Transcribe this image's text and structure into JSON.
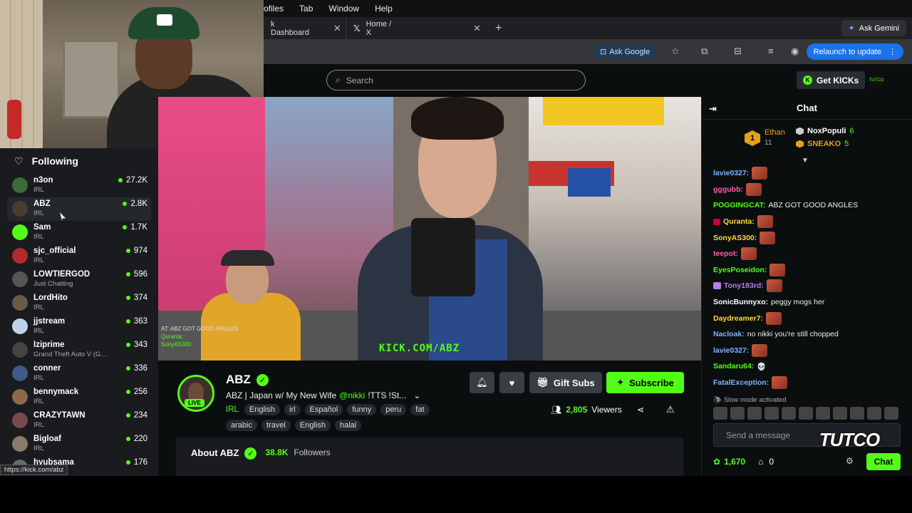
{
  "menubar": {
    "items": [
      "ofiles",
      "Tab",
      "Window",
      "Help"
    ]
  },
  "tabs": [
    {
      "label": "k Dashboard"
    },
    {
      "label": "Home / X"
    }
  ],
  "ask_gemini": "Ask Gemini",
  "toolbar": {
    "ask_google": "Ask Google",
    "relaunch": "Relaunch to update"
  },
  "header": {
    "search_placeholder": "Search",
    "get_kicks": "Get KICKs",
    "avatar_label": "TUTCO"
  },
  "sidebar": {
    "title": "Following",
    "items": [
      {
        "name": "n3on",
        "category": "IRL",
        "viewers": "27.2K",
        "color": "#3b6b3b"
      },
      {
        "name": "ABZ",
        "category": "IRL",
        "viewers": "2.8K",
        "color": "#4a3b30"
      },
      {
        "name": "Sam",
        "category": "IRL",
        "viewers": "1.7K",
        "color": "#53fc18"
      },
      {
        "name": "sjc_official",
        "category": "IRL",
        "viewers": "974",
        "color": "#b02b2b"
      },
      {
        "name": "LOWTIERGOD",
        "category": "Just Chatting",
        "viewers": "596",
        "color": "#555"
      },
      {
        "name": "LordHito",
        "category": "IRL",
        "viewers": "374",
        "color": "#6a5a4a"
      },
      {
        "name": "jjstream",
        "category": "IRL",
        "viewers": "363",
        "color": "#bcd3ea"
      },
      {
        "name": "Iziprime",
        "category": "Grand Theft Auto V (G...",
        "viewers": "343",
        "color": "#444"
      },
      {
        "name": "conner",
        "category": "IRL",
        "viewers": "336",
        "color": "#3f5a8a"
      },
      {
        "name": "bennymack",
        "category": "IRL",
        "viewers": "256",
        "color": "#8a6a4a"
      },
      {
        "name": "CRAZYTAWN",
        "category": "IRL",
        "viewers": "234",
        "color": "#7a4a4a"
      },
      {
        "name": "Bigloaf",
        "category": "IRL",
        "viewers": "220",
        "color": "#8a7a6a"
      },
      {
        "name": "hyubsama",
        "category": "",
        "viewers": "176",
        "color": "#6a6a6a"
      }
    ],
    "status_url": "https://kick.com/abz"
  },
  "video": {
    "watermark": "KICK.COM/ABZ",
    "overlay_lines": [
      "AT: ABZ GOT GOOD ANGLES",
      "Quranta:",
      "SonyAS300:"
    ]
  },
  "stream": {
    "streamer": "ABZ",
    "live": "LIVE",
    "title_prefix": "ABZ | Japan w/ My New Wife",
    "title_mention": "@nikki",
    "title_suffix": "!TTS !St...",
    "category": "IRL",
    "tags": [
      "English",
      "irl",
      "Español",
      "funny",
      "peru",
      "fat",
      "arabic",
      "travel",
      "English",
      "halal"
    ],
    "gift_subs": "Gift Subs",
    "subscribe": "Subscribe",
    "viewers_count": "2,805",
    "viewers_label": "Viewers",
    "about": "About ABZ",
    "followers_count": "38.8K",
    "followers_label": "Followers"
  },
  "chat": {
    "title": "Chat",
    "leaderboard": {
      "first_rank": "1",
      "first_name": "Ethan",
      "first_count": "11",
      "second_name": "NoxPopuli",
      "second_count": "6",
      "third_name": "SNEAKO",
      "third_count": "5"
    },
    "messages": [
      {
        "user": "lavie0327:",
        "color": "#7fb2ff",
        "text": "",
        "emote": true
      },
      {
        "user": "gggubb:",
        "color": "#ff5ea8",
        "text": "",
        "emote": true
      },
      {
        "user": "POGGINGCAT:",
        "color": "#53fc18",
        "text": "ABZ GOT GOOD ANGLES",
        "emote": false
      },
      {
        "user": "Quranta:",
        "color": "#ffd93b",
        "text": "",
        "emote": true
      },
      {
        "user": "SonyAS300:",
        "color": "#ffd93b",
        "text": "",
        "emote": true
      },
      {
        "user": "teepot:",
        "color": "#ff5ea8",
        "text": "",
        "emote": true
      },
      {
        "user": "EyesPoseidon:",
        "color": "#53fc18",
        "text": "",
        "emote": true
      },
      {
        "user": "Tony183rd:",
        "color": "#b87de8",
        "text": "",
        "emote": true
      },
      {
        "user": "SonicBunnyxo:",
        "color": "#ffffff",
        "text": "peggy mogs her",
        "emote": false
      },
      {
        "user": "Daydreamer7:",
        "color": "#ffd93b",
        "text": "",
        "emote": true
      },
      {
        "user": "Nacloak:",
        "color": "#7fb2ff",
        "text": "no nikki you're still chopped",
        "emote": false
      },
      {
        "user": "lavie0327:",
        "color": "#7fb2ff",
        "text": "",
        "emote": true
      },
      {
        "user": "Sandaru64:",
        "color": "#53fc18",
        "text": "💀",
        "emote": false
      },
      {
        "user": "FatalException:",
        "color": "#7fb2ff",
        "text": "",
        "emote": true
      }
    ],
    "slow_mode": "Slow mode activated",
    "input_placeholder": "Send a message",
    "watermark_text": "TUTCO",
    "kicks": "1,670",
    "store_count": "0",
    "send_label": "Chat"
  }
}
